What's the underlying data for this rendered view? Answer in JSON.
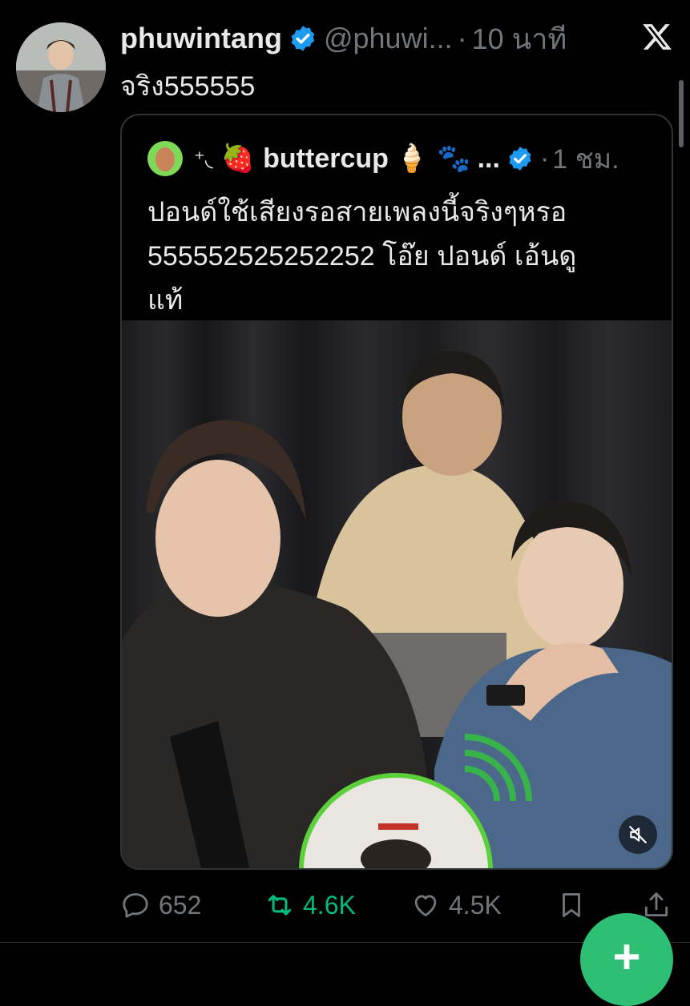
{
  "tweet": {
    "display_name": "phuwintang",
    "handle": "@phuwi...",
    "separator": "·",
    "time": "10 นาที",
    "text": "จริง555555",
    "logo_icon": "x-logo-icon",
    "avatar_icon": "profile-avatar"
  },
  "quote": {
    "decoration": "⁺◟",
    "strawberry": "🍓",
    "display_name": "buttercup",
    "ice_cream": "🍦",
    "paws": "🐾",
    "ellipsis": "...",
    "separator": "·",
    "time": "1 ชม.",
    "text_line1": "ปอนด์ใช้เสียงรอสายเพลงนี้จริงๆหรอ",
    "text_line2": "555552525252252 โอ๊ย ปอนด์ เอ้นดู",
    "text_line3": "แท้",
    "media_icon": "video-thumbnail",
    "mute_icon": "muted-speaker-icon"
  },
  "actions": {
    "replies": "652",
    "reposts": "4.6K",
    "likes": "4.5K"
  },
  "colors": {
    "background": "#000000",
    "text": "#e7e9ea",
    "muted": "#71767b",
    "verified": "#1d9bf0",
    "repost": "#00ba7c",
    "border": "#2f3336"
  }
}
